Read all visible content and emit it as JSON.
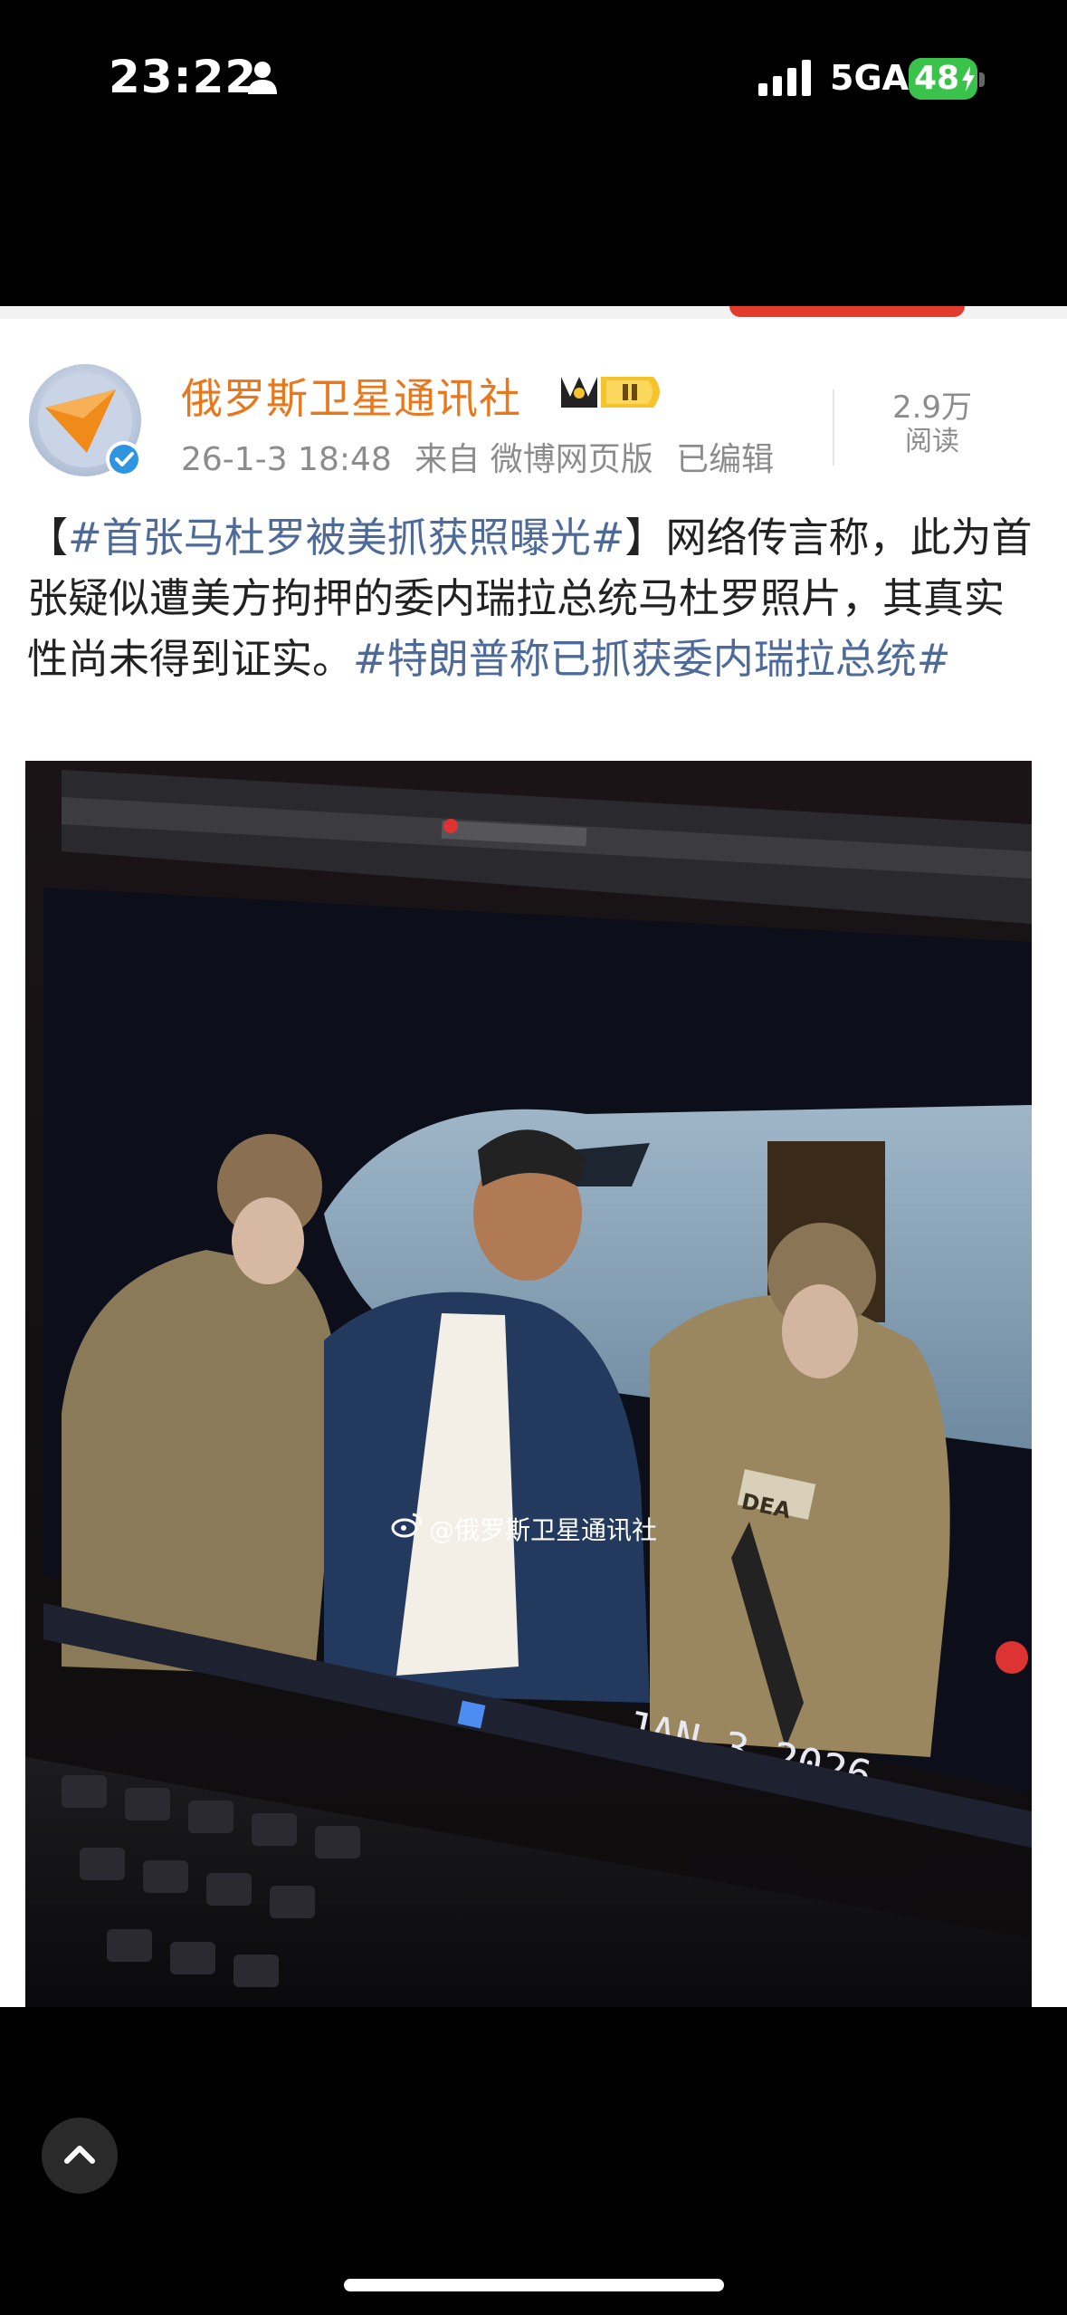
{
  "status_bar": {
    "time": "23:22",
    "network": "5GA",
    "battery": "48"
  },
  "post": {
    "author": "俄罗斯卫星通讯社",
    "date": "26-1-3 18:48",
    "source": "来自 微博网页版",
    "edited": "已编辑",
    "reads_count": "2.9万",
    "reads_label": "阅读",
    "bracket_open": "【",
    "hashtag_1": "#首张马杜罗被美抓获照曝光#",
    "bracket_close": "】",
    "body_text": "网络传言称，此为首张疑似遭美方拘押的委内瑞拉总统马杜罗照片，其真实性尚未得到证实。",
    "hashtag_2": "#特朗普称已抓获委内瑞拉总统#"
  },
  "photo": {
    "date_stamp": "JAN 3 2026",
    "vest_label": "DEA",
    "watermark": "@俄罗斯卫星通讯社"
  },
  "colors": {
    "author": "#e9771c",
    "hashtag": "#4e6a99",
    "meta": "#8c8c8c",
    "battery": "#3ac34b"
  }
}
